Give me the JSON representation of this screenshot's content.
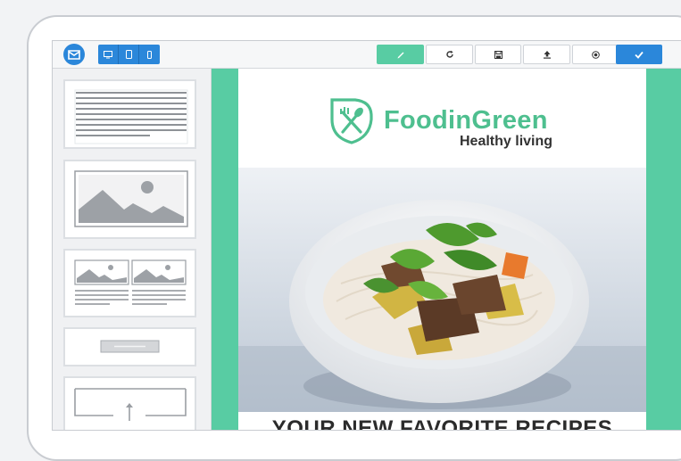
{
  "editor": {
    "brand_logo": "envelope-logo",
    "view_modes": [
      {
        "name": "desktop-view",
        "icon": "monitor-icon"
      },
      {
        "name": "tablet-view",
        "icon": "tablet-icon"
      },
      {
        "name": "mobile-view",
        "icon": "phone-icon"
      }
    ],
    "actions": [
      {
        "name": "edit",
        "icon": "pencil-icon"
      },
      {
        "name": "refresh",
        "icon": "refresh-icon"
      },
      {
        "name": "save",
        "icon": "save-icon"
      },
      {
        "name": "upload",
        "icon": "upload-icon"
      },
      {
        "name": "preview",
        "icon": "record-icon"
      },
      {
        "name": "confirm",
        "icon": "check-icon"
      }
    ],
    "colors": {
      "accent_blue": "#2b87da",
      "accent_green": "#58cca3",
      "brand_green": "#4ebf8f"
    }
  },
  "sidebar": {
    "blocks": [
      {
        "name": "text-block"
      },
      {
        "name": "image-block"
      },
      {
        "name": "two-column-image-text-block"
      },
      {
        "name": "button-block"
      },
      {
        "name": "spacer-block"
      }
    ]
  },
  "email": {
    "brand_name": "FoodinGreen",
    "tagline": "Healthy living",
    "headline": "YOUR NEW FAVORITE RECIPES"
  }
}
